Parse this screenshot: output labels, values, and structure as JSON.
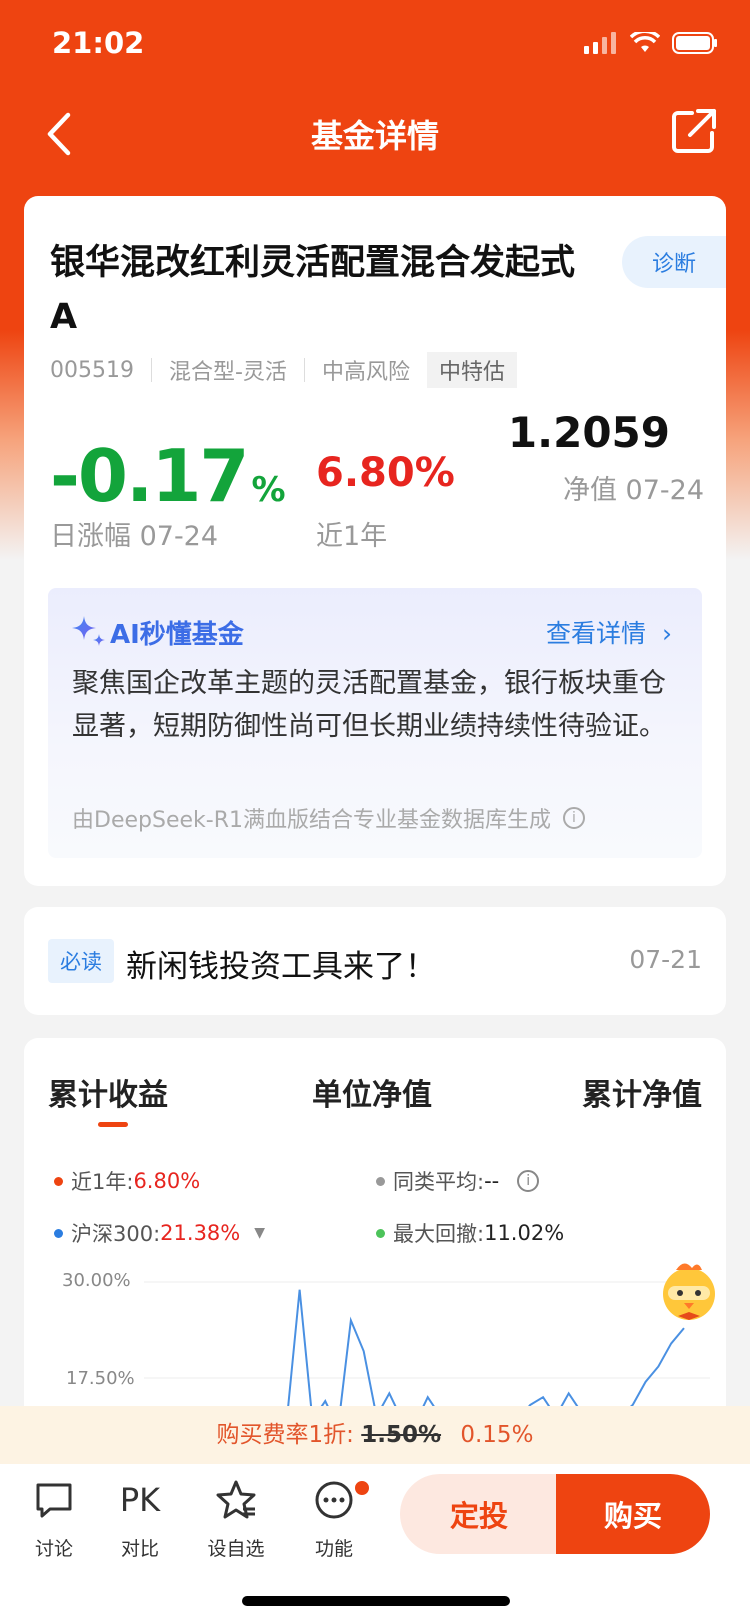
{
  "status_bar": {
    "time": "21:02"
  },
  "nav": {
    "title": "基金详情"
  },
  "fund": {
    "name": "银华混改红利灵活配置混合发起式A",
    "diagnose_label": "诊断",
    "code": "005519",
    "type": "混合型-灵活",
    "risk": "中高风险",
    "tag": "中特估",
    "daily_change_value": "-0.17",
    "daily_change_unit": "%",
    "daily_change_label": "日涨幅 07-24",
    "year_return": "6.80%",
    "year_return_label": "近1年",
    "nav_value": "1.2059",
    "nav_label": "净值 07-24"
  },
  "ai_summary": {
    "title": "AI秒懂基金",
    "more_label": "查看详情",
    "text": "聚焦国企改革主题的灵活配置基金，银行板块重仓显著，短期防御性尚可但长期业绩持续性待验证。",
    "source": "由DeepSeek-R1满血版结合专业基金数据库生成"
  },
  "news": {
    "badge": "必读",
    "text": "新闲钱投资工具来了！",
    "date": "07-21"
  },
  "chart_tabs": [
    "累计收益",
    "单位净值",
    "累计净值"
  ],
  "legend": {
    "year_label": "近1年:",
    "year_value": "6.80%",
    "avg_label": "同类平均:",
    "avg_value": "--",
    "hs300_label": "沪深300:",
    "hs300_value": "21.38%",
    "drawdown_label": "最大回撤:",
    "drawdown_value": "11.02%"
  },
  "colors": {
    "brand": "#ee4411",
    "fund_line": "#4a90e2",
    "up": "#e7251f",
    "down": "#13a43b"
  },
  "chart_data": {
    "type": "line",
    "y_tick_labels": [
      "30.00%",
      "17.50%"
    ],
    "ylim": [
      0,
      30
    ],
    "series": [
      {
        "name": "沪深300",
        "values": [
          8.5,
          12.0,
          29.0,
          12.0,
          14.5,
          10.0,
          25.0,
          21.0,
          12.5,
          15.5,
          12.0,
          11.5,
          15.0,
          12.5,
          13.0,
          11.0,
          11.0,
          12.5,
          13.0,
          12.0,
          14.0,
          15.0,
          12.5,
          15.5,
          13.0,
          11.5,
          12.0,
          12.5,
          14.0,
          17.0,
          19.0,
          22.0,
          24.0
        ]
      }
    ]
  },
  "fee": {
    "label": "购买费率1折:",
    "old_rate": "1.50%",
    "new_rate": "0.15%"
  },
  "bottom_tools": [
    {
      "label": "讨论"
    },
    {
      "label": "对比",
      "icon_text": "PK"
    },
    {
      "label": "设自选"
    },
    {
      "label": "功能"
    }
  ],
  "actions": {
    "dingtou": "定投",
    "buy": "购买"
  }
}
